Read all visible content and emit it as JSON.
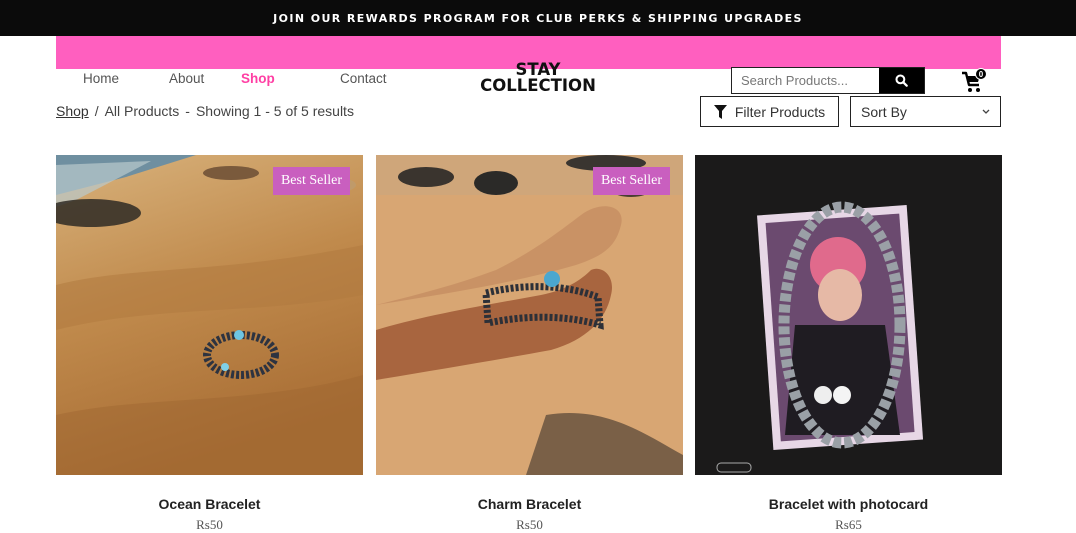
{
  "announcement": "JOIN OUR REWARDS PROGRAM FOR CLUB PERKS & SHIPPING UPGRADES",
  "nav": {
    "home": "Home",
    "about": "About",
    "shop": "Shop",
    "contact": "Contact"
  },
  "logo": {
    "line1": "STAY",
    "line2": "COLLECTION"
  },
  "search": {
    "placeholder": "Search Products..."
  },
  "cart": {
    "count": "0"
  },
  "breadcrumb": {
    "shop": "Shop",
    "sep": "/",
    "current": "All Products",
    "dash": "-",
    "results": "Showing 1 - 5 of 5 results"
  },
  "filter": {
    "label": "Filter Products"
  },
  "sort": {
    "label": "Sort By"
  },
  "colors": {
    "accent": "#ff5fbf",
    "active_nav": "#ff3fa4",
    "badge": "#c95fbf",
    "announcement_bg": "#0b0b0b"
  },
  "products": [
    {
      "name": "Ocean Bracelet",
      "price": "Rs50",
      "badge": "Best Seller"
    },
    {
      "name": "Charm Bracelet",
      "price": "Rs50",
      "badge": "Best Seller"
    },
    {
      "name": "Bracelet with photocard",
      "price": "Rs65"
    }
  ]
}
